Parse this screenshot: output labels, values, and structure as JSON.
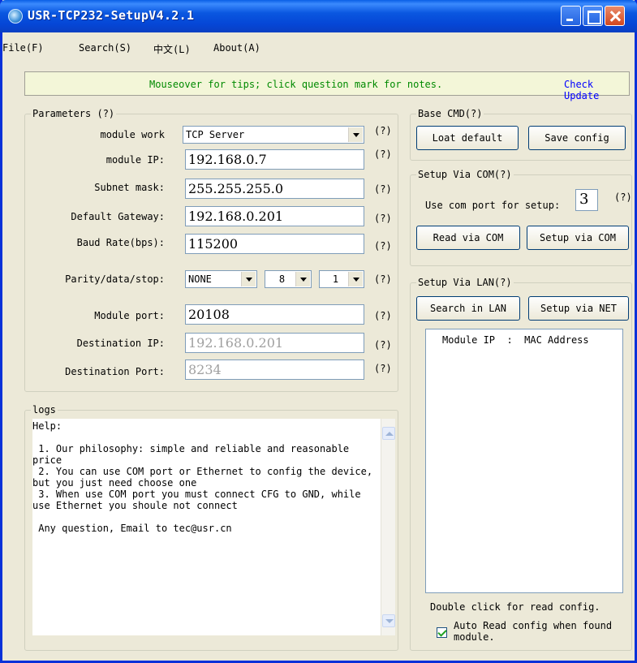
{
  "window": {
    "title": "USR-TCP232-SetupV4.2.1"
  },
  "menu": [
    "File(F)",
    "Search(S)",
    "中文(L)",
    "About(A)"
  ],
  "tipbar": {
    "text": "Mouseover for tips; click question mark for notes.",
    "check_update": "Check Update"
  },
  "parameters": {
    "legend": "Parameters (?)",
    "q": "(?)",
    "module_work": {
      "label": "module work",
      "value": "TCP Server"
    },
    "module_ip": {
      "label": "module IP:",
      "value": "192.168.0.7"
    },
    "subnet": {
      "label": "Subnet mask:",
      "value": "255.255.255.0"
    },
    "gateway": {
      "label": "Default Gateway:",
      "value": "192.168.0.201"
    },
    "baud": {
      "label": "Baud Rate(bps):",
      "value": "115200"
    },
    "parity": {
      "label": "Parity/data/stop:",
      "parity": "NONE",
      "data": "8",
      "stop": "1"
    },
    "module_port": {
      "label": "Module port:",
      "value": "20108"
    },
    "dest_ip": {
      "label": "Destination IP:",
      "value": "192.168.0.201"
    },
    "dest_port": {
      "label": "Destination Port:",
      "value": "8234"
    }
  },
  "logs": {
    "legend": "logs",
    "text": "Help:\n\n 1. Our philosophy: simple and reliable and reasonable price\n 2. You can use COM port or Ethernet to config the device, but you just need choose one\n 3. When use COM port you must connect CFG to GND, while use Ethernet you shoule not connect\n\n Any question, Email to tec@usr.cn"
  },
  "base_cmd": {
    "legend": "Base CMD(?)",
    "load_default": "Loat default",
    "save_config": "Save config"
  },
  "setup_com": {
    "legend": "Setup Via COM(?)",
    "use_port_label": "Use com port for setup:",
    "port": "3",
    "q": "(?)",
    "read": "Read via COM",
    "setup": "Setup via COM"
  },
  "setup_lan": {
    "legend": "Setup Via LAN(?)",
    "search": "Search in LAN",
    "setup": "Setup via NET",
    "list_header": "Module IP  :  MAC Address",
    "hint": "Double click for read config.",
    "auto_read": "Auto Read config when found module.",
    "auto_read_checked": true
  }
}
